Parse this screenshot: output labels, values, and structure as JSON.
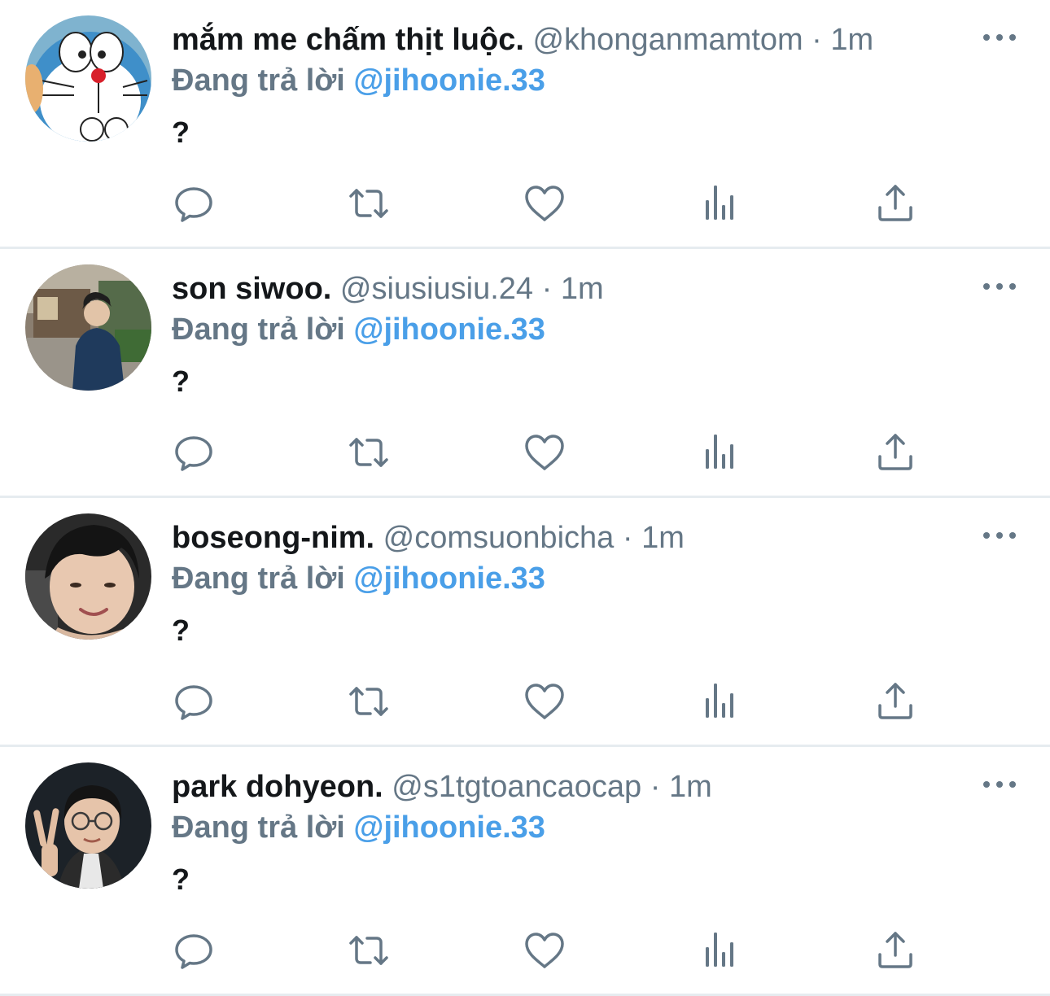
{
  "tweets": [
    {
      "display_name": "mắm me chấm thịt luộc.",
      "handle": "@khonganmamtom",
      "separator": " · ",
      "time": "1m",
      "reply_prefix": "Đang trả lời ",
      "reply_to": "@jihoonie.33",
      "text": "?",
      "avatar_icon": "doraemon-avatar"
    },
    {
      "display_name": "son siwoo.",
      "handle": "@siusiusiu.24",
      "separator": " · ",
      "time": "1m",
      "reply_prefix": "Đang trả lời ",
      "reply_to": "@jihoonie.33",
      "text": "?",
      "avatar_icon": "person-photo-avatar"
    },
    {
      "display_name": "boseong-nim.",
      "handle": "@comsuonbicha",
      "separator": " · ",
      "time": "1m",
      "reply_prefix": "Đang trả lời ",
      "reply_to": "@jihoonie.33",
      "text": "?",
      "avatar_icon": "person-photo-avatar"
    },
    {
      "display_name": "park dohyeon.",
      "handle": "@s1tgtoancaocap",
      "separator": " · ",
      "time": "1m",
      "reply_prefix": "Đang trả lời ",
      "reply_to": "@jihoonie.33",
      "text": "?",
      "avatar_icon": "person-photo-avatar"
    }
  ],
  "action_icons": [
    "reply-icon",
    "retweet-icon",
    "like-icon",
    "analytics-icon",
    "share-icon"
  ],
  "colors": {
    "name": "#14171a",
    "secondary": "#657786",
    "mention": "#4a9fe8",
    "divider": "#e6ecf0",
    "icon": "#657786"
  }
}
